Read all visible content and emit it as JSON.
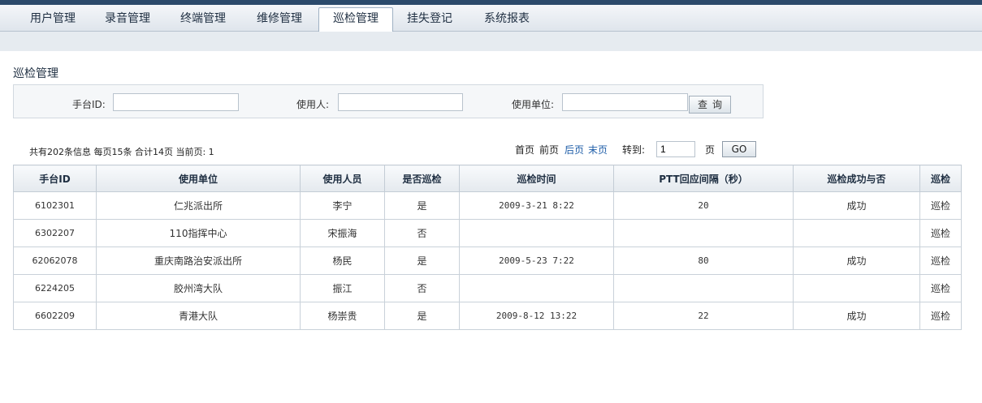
{
  "nav": {
    "tabs": [
      "用户管理",
      "录音管理",
      "终端管理",
      "维修管理",
      "巡检管理",
      "挂失登记",
      "系统报表"
    ],
    "active": "巡检管理"
  },
  "page": {
    "title": "巡检管理"
  },
  "search": {
    "device_label": "手台ID:",
    "user_label": "使用人:",
    "unit_label": "使用单位:",
    "button_label": "查询",
    "device_value": "",
    "user_value": "",
    "unit_value": ""
  },
  "pager": {
    "summary": "共有202条信息 每页15条 合计14页 当前页: 1",
    "first": "首页",
    "prev": "前页",
    "next": "后页",
    "last": "末页",
    "goto_label": "转到:",
    "goto_value": "1",
    "page_suffix": "页",
    "go": "GO"
  },
  "table": {
    "headers": [
      "手台ID",
      "使用单位",
      "使用人员",
      "是否巡检",
      "巡检时间",
      "PTT回应间隔（秒）",
      "巡检成功与否",
      "巡检"
    ],
    "rows": [
      {
        "id": "6102301",
        "unit": "仁兆派出所",
        "person": "李宁",
        "inspected": "是",
        "time": "2009-3-21 8:22",
        "ptt": "20",
        "result": "成功",
        "action": "巡检"
      },
      {
        "id": "6302207",
        "unit": "110指挥中心",
        "person": "宋振海",
        "inspected": "否",
        "time": "",
        "ptt": "",
        "result": "",
        "action": "巡检"
      },
      {
        "id": "62062078",
        "unit": "重庆南路治安派出所",
        "person": "杨民",
        "inspected": "是",
        "time": "2009-5-23 7:22",
        "ptt": "80",
        "result": "成功",
        "action": "巡检"
      },
      {
        "id": "6224205",
        "unit": "胶州湾大队",
        "person": "振江",
        "inspected": "否",
        "time": "",
        "ptt": "",
        "result": "",
        "action": "巡检"
      },
      {
        "id": "6602209",
        "unit": "青港大队",
        "person": "杨崇贵",
        "inspected": "是",
        "time": "2009-8-12 13:22",
        "ptt": "22",
        "result": "成功",
        "action": "巡检"
      }
    ]
  }
}
